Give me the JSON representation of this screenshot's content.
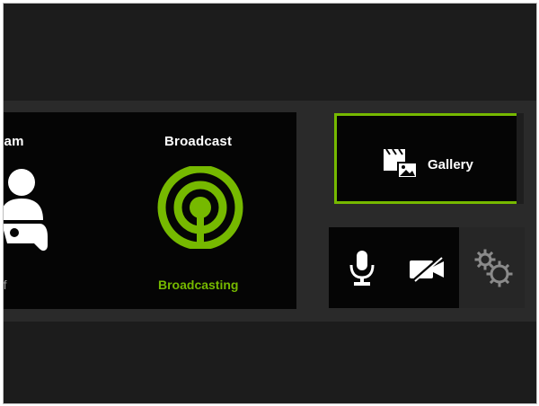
{
  "tiles": {
    "stream": {
      "title": "eam",
      "status": "ff"
    },
    "broadcast": {
      "title": "Broadcast",
      "status": "Broadcasting"
    },
    "gallery": {
      "label": "Gallery"
    }
  },
  "controls": [
    {
      "icon": "microphone-icon"
    },
    {
      "icon": "camera-off-icon"
    },
    {
      "icon": "gear-icon"
    }
  ],
  "colors": {
    "accent": "#76b900",
    "background": "#1c1c1c",
    "panel": "#050505"
  }
}
